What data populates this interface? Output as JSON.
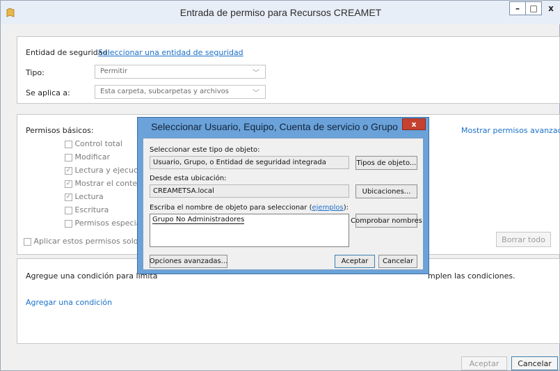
{
  "window": {
    "title": "Entrada de permiso para Recursos CREAMET",
    "minimize": "–",
    "maximize": "□",
    "close": "x"
  },
  "principal": {
    "label": "Entidad de seguridad:",
    "link": "Seleccionar una entidad de seguridad"
  },
  "type": {
    "label": "Tipo:",
    "value": "Permitir"
  },
  "applies": {
    "label": "Se aplica a:",
    "value": "Esta carpeta, subcarpetas y archivos"
  },
  "permissions": {
    "label": "Permisos básicos:",
    "advanced_link": "Mostrar permisos avanzados",
    "items": [
      {
        "label": "Control total",
        "checked": false
      },
      {
        "label": "Modificar",
        "checked": false
      },
      {
        "label": "Lectura y ejecución",
        "checked": true
      },
      {
        "label": "Mostrar el contenid",
        "checked": true
      },
      {
        "label": "Lectura",
        "checked": true
      },
      {
        "label": "Escritura",
        "checked": false
      },
      {
        "label": "Permisos especiales",
        "checked": false
      }
    ],
    "apply_only": "Aplicar estos permisos solo a obj",
    "clear_all": "Borrar todo"
  },
  "condition": {
    "text_left": "Agregue una condición para limita",
    "text_right": "mplen las condiciones.",
    "add_link": "Agregar una condición"
  },
  "footer": {
    "ok": "Aceptar",
    "cancel": "Cancelar"
  },
  "dialog": {
    "title": "Seleccionar Usuario, Equipo, Cuenta de servicio o Grupo",
    "close": "x",
    "object_type_label": "Seleccionar este tipo de objeto:",
    "object_type_value": "Usuario, Grupo, o Entidad de seguridad integrada",
    "object_types_button": "Tipos de objeto...",
    "location_label": "Desde esta ubicación:",
    "location_value": "CREAMETSA.local",
    "locations_button": "Ubicaciones...",
    "name_label_prefix": "Escriba el nombre de objeto para seleccionar (",
    "name_label_link": "ejemplos",
    "name_label_suffix": "):",
    "name_value": "Grupo No Administradores",
    "check_names_button": "Comprobar nombres",
    "advanced_button": "Opciones avanzadas...",
    "ok_button": "Aceptar",
    "cancel_button": "Cancelar"
  }
}
